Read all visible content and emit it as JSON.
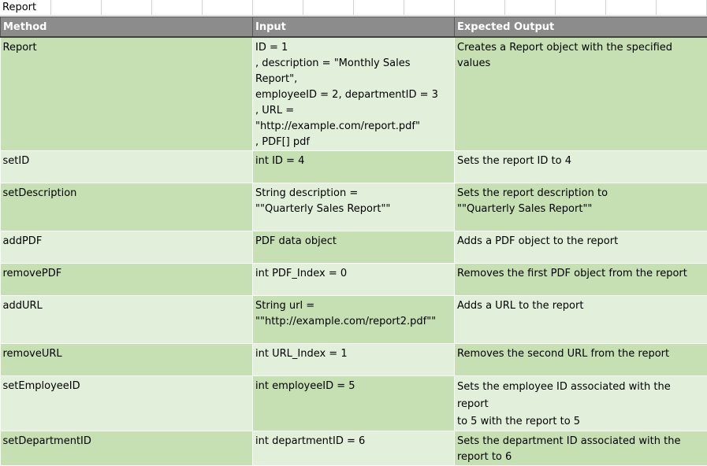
{
  "sheet_title": "Report",
  "columns": [
    "Method",
    "Input",
    "Expected Output"
  ],
  "rows": [
    {
      "method": "Report",
      "input": "ID = 1\n, description = \"Monthly Sales Report\",\nemployeeID = 2, departmentID = 3\n, URL = \"http://example.com/report.pdf\"\n, PDF[] pdf",
      "output": "Creates a Report object with the specified values"
    },
    {
      "method": "setID",
      "input": "int ID = 4",
      "output": "Sets the report ID to 4"
    },
    {
      "method": "setDescription",
      "input": "String description =\n \"\"Quarterly Sales Report\"\"",
      "output": "Sets the report description to\n\"\"Quarterly Sales Report\"\""
    },
    {
      "method": "addPDF",
      "input": "PDF data object",
      "output": "Adds a PDF object to the report"
    },
    {
      "method": "removePDF",
      "input": "int PDF_Index = 0",
      "output": "Removes the first PDF object from the report"
    },
    {
      "method": "addURL",
      "input": "String url =\n \"\"http://example.com/report2.pdf\"\"",
      "output": "Adds a URL to the report"
    },
    {
      "method": "removeURL",
      "input": "int URL_Index = 1",
      "output": "Removes the second URL from the report"
    },
    {
      "method": "setEmployeeID",
      "input": "int employeeID = 5",
      "output": "Sets the employee ID associated with the report\nto 5 with the report to 5"
    },
    {
      "method": "setDepartmentID",
      "input": "int departmentID = 6",
      "output": "Sets the department ID associated with the\nreport to 6"
    }
  ]
}
